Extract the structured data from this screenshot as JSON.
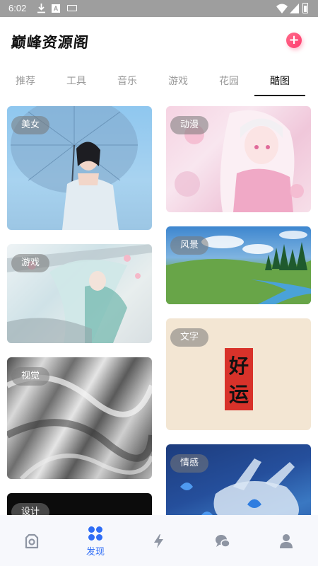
{
  "status_bar": {
    "time": "6:02",
    "icons": [
      "download-icon",
      "a-notification-icon",
      "keyboard-icon",
      "wifi-icon",
      "signal-icon",
      "battery-icon"
    ]
  },
  "header": {
    "title": "巅峰资源阁",
    "add_icon": "plus-icon"
  },
  "tabs": [
    {
      "label": "推荐",
      "active": false
    },
    {
      "label": "工具",
      "active": false
    },
    {
      "label": "音乐",
      "active": false
    },
    {
      "label": "游戏",
      "active": false
    },
    {
      "label": "花园",
      "active": false
    },
    {
      "label": "酷图",
      "active": true
    }
  ],
  "cards": {
    "left": [
      {
        "label": "美女"
      },
      {
        "label": "游戏"
      },
      {
        "label": "视觉"
      },
      {
        "label": "设计"
      }
    ],
    "right": [
      {
        "label": "动漫"
      },
      {
        "label": "风景"
      },
      {
        "label": "文字",
        "art_text": [
          "好",
          "运"
        ]
      },
      {
        "label": "情感"
      }
    ]
  },
  "bottom_nav": [
    {
      "icon": "camera-icon",
      "label": "",
      "active": false
    },
    {
      "icon": "grid-icon",
      "label": "发现",
      "active": true
    },
    {
      "icon": "lightning-icon",
      "label": "",
      "active": false
    },
    {
      "icon": "chat-icon",
      "label": "",
      "active": false
    },
    {
      "icon": "user-icon",
      "label": "",
      "active": false
    }
  ],
  "colors": {
    "accent": "#2f6df6",
    "add_button": "#ff4f7a",
    "inactive_tab": "#9a9a9a",
    "nav_inactive": "#8e95a3"
  }
}
